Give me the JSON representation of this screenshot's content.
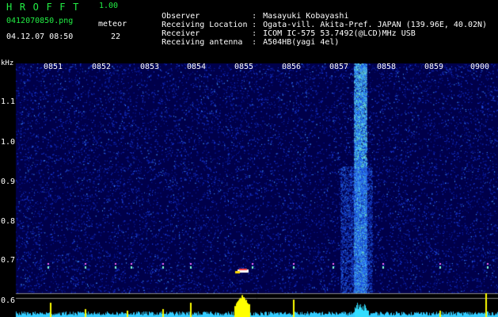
{
  "header": {
    "app_name": "HROFFT",
    "version": "1.00",
    "filename": "0412070850.png",
    "meteor_label": "meteor",
    "meteor_count": "22",
    "datetime": "04.12.07 08:50"
  },
  "info": [
    {
      "key": "Observer",
      "value": "Masayuki Kobayashi"
    },
    {
      "key": "Receiving Location",
      "value": "Ogata-vill. Akita-Pref. JAPAN (139.96E, 40.02N)"
    },
    {
      "key": "Receiver",
      "value": "ICOM IC-575 53.7492(@LCD)MHz USB"
    },
    {
      "key": "Receiving antenna",
      "value": "A504HB(yagi 4el)"
    }
  ],
  "spectrogram": {
    "y_unit": "kHz",
    "time_labels": [
      "0851",
      "0852",
      "0853",
      "0854",
      "0855",
      "0856",
      "0857",
      "0858",
      "0859",
      "0900"
    ],
    "freq_labels": [
      "1.1",
      "1.0",
      "0.9",
      "0.8",
      "0.7",
      "0.6"
    ],
    "colors": {
      "background": "#00004a",
      "noise_low": "#0a1a9a",
      "noise_high": "#3c8cff",
      "signal": "#7fffd4",
      "axis_text": "#ffffff",
      "meteor_bar": "#ffff00",
      "grid_line": "#888888"
    }
  }
}
